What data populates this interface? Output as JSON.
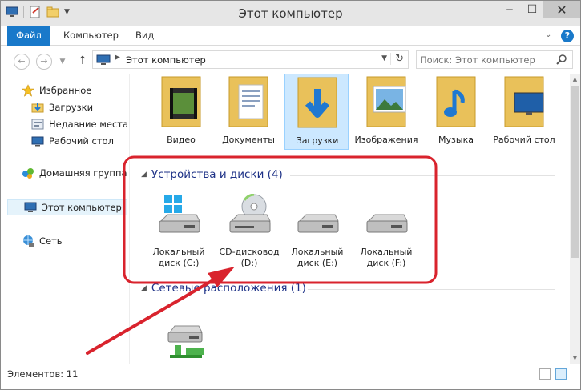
{
  "window": {
    "title": "Этот компьютер"
  },
  "ribbon": {
    "tabs": [
      {
        "label": "Файл"
      },
      {
        "label": "Компьютер"
      },
      {
        "label": "Вид"
      }
    ]
  },
  "address": {
    "path": "Этот компьютер"
  },
  "search": {
    "placeholder": "Поиск: Этот компьютер"
  },
  "navpane": {
    "items": [
      {
        "label": "Избранное",
        "icon": "star-icon"
      },
      {
        "label": "Загрузки",
        "icon": "downloads-folder-icon"
      },
      {
        "label": "Недавние места",
        "icon": "recent-places-icon"
      },
      {
        "label": "Рабочий стол",
        "icon": "desktop-icon"
      },
      {
        "label": "Домашняя группа",
        "icon": "homegroup-icon"
      },
      {
        "label": "Этот компьютер",
        "icon": "computer-icon",
        "selected": true
      },
      {
        "label": "Сеть",
        "icon": "network-icon"
      }
    ]
  },
  "folders": [
    {
      "label": "Видео",
      "icon": "video-folder-icon"
    },
    {
      "label": "Документы",
      "icon": "documents-folder-icon"
    },
    {
      "label": "Загрузки",
      "icon": "downloads-folder-icon",
      "selected": true
    },
    {
      "label": "Изображения",
      "icon": "pictures-folder-icon"
    },
    {
      "label": "Музыка",
      "icon": "music-folder-icon"
    },
    {
      "label": "Рабочий стол",
      "icon": "desktop-folder-icon"
    }
  ],
  "devices_group": {
    "title": "Устройства и диски (4)"
  },
  "drives": [
    {
      "label": "Локальный диск (C:)",
      "icon": "system-drive-icon"
    },
    {
      "label": "CD-дисковод (D:)",
      "icon": "cd-drive-icon"
    },
    {
      "label": "Локальный диск (E:)",
      "icon": "hard-drive-icon"
    },
    {
      "label": "Локальный диск (F:)",
      "icon": "hard-drive-icon"
    }
  ],
  "network_group": {
    "title": "Сетевые расположения (1)"
  },
  "network_locations": [
    {
      "icon": "network-drive-icon"
    }
  ],
  "status": {
    "items_count": "Элементов: 11"
  },
  "colors": {
    "accent": "#1979ca",
    "group_title": "#1e3287",
    "annotation": "#d9232d",
    "selection": "#cce8ff"
  }
}
